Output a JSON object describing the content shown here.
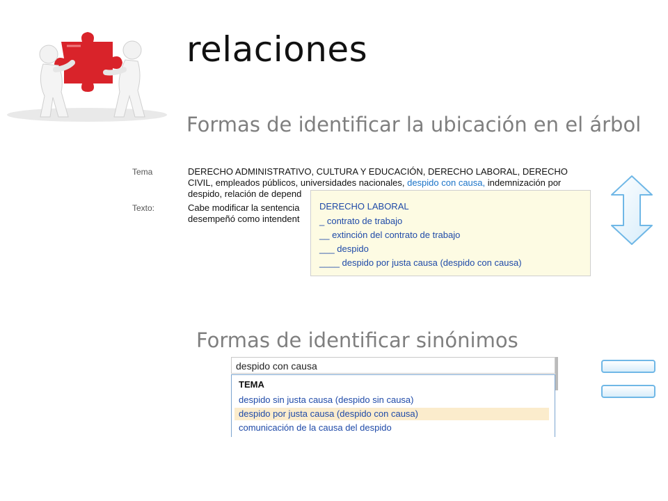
{
  "title": "relaciones",
  "subtitles": {
    "tree": "Formas de identificar la ubicación en el árbol",
    "synonyms": "Formas de identificar sinónimos"
  },
  "record": {
    "tema_label": "Tema",
    "tema_text_1": "DERECHO ADMINISTRATIVO, CULTURA Y EDUCACIÓN, DERECHO LABORAL, DERECHO",
    "tema_text_2a": "CIVIL, empleados públicos, universidades nacionales,",
    "tema_link": "despido con causa,",
    "tema_text_2b": "indemnización por",
    "tema_text_3": "despido, relación de depend",
    "texto_label": "Texto:",
    "texto_line_1": "Cabe modificar la sentencia",
    "texto_line_2": "desempeñó como intendent"
  },
  "tree_popup": {
    "items": [
      "DERECHO LABORAL",
      "_ contrato de trabajo",
      "__ extinción del contrato de trabajo",
      "___ despido",
      "____ despido por justa causa (despido con causa)"
    ]
  },
  "search": {
    "value": "despido con causa",
    "header": "TEMA",
    "results": [
      "despido sin justa causa (despido sin causa)",
      "despido por justa causa (despido con causa)",
      "comunicación de la causa del despido"
    ],
    "highlighted_index": 1
  },
  "colors": {
    "link": "#1a73c8",
    "tree_bg": "#fdfbe3",
    "highlight_bg": "#fbeccc",
    "arrow_stroke": "#6fb7e6",
    "puzzle": "#d9232a"
  },
  "icons": {
    "logo": "people-puzzle-icon",
    "tree_arrow": "up-down-arrow-icon",
    "synonym": "equals-icon"
  }
}
